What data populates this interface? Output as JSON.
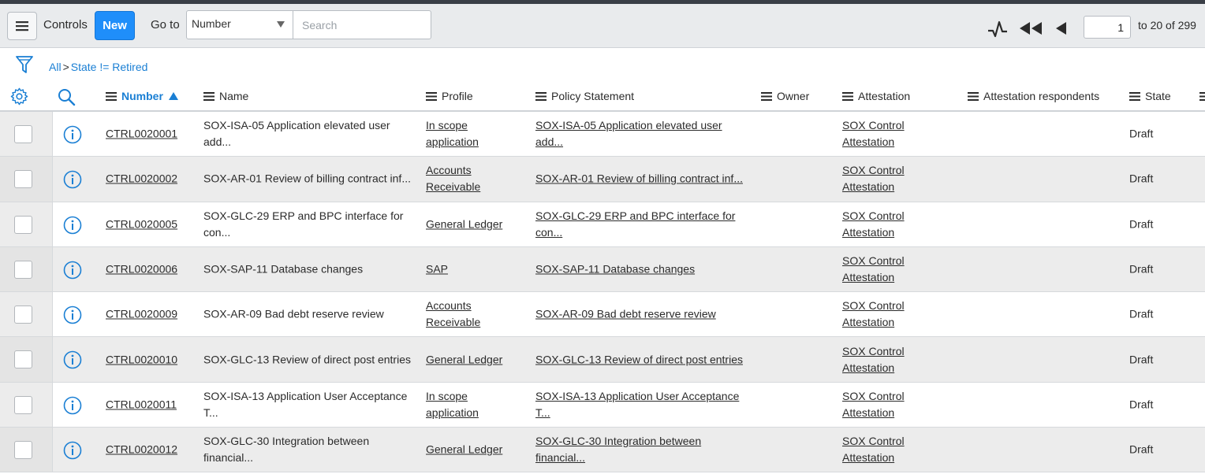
{
  "toolbar": {
    "title": "Controls",
    "new_label": "New",
    "goto_label": "Go to",
    "goto_field": "Number",
    "search_placeholder": "Search",
    "page_value": "1",
    "range_text": "to 20 of 299"
  },
  "breadcrumb": {
    "items": [
      "All",
      "State != Retired"
    ],
    "separator": ">"
  },
  "columns": {
    "number": "Number",
    "name": "Name",
    "profile": "Profile",
    "policy": "Policy Statement",
    "owner": "Owner",
    "attestation": "Attestation",
    "respondents": "Attestation respondents",
    "state": "State"
  },
  "colors": {
    "accent": "#1f8efa",
    "link_blue": "#1a7fd4",
    "toolbar_bg": "#e9ebed",
    "row_alt_bg": "#ececec"
  },
  "rows": [
    {
      "number": "CTRL0020001",
      "name": "SOX-ISA-05 Application elevated user add...",
      "profile": "In scope application",
      "policy": "SOX-ISA-05 Application elevated user add...",
      "owner": "",
      "attestation": "SOX Control Attestation",
      "respondents": "",
      "state": "Draft"
    },
    {
      "number": "CTRL0020002",
      "name": "SOX-AR-01 Review of billing contract inf...",
      "profile": "Accounts Receivable",
      "policy": "SOX-AR-01 Review of billing contract inf...",
      "owner": "",
      "attestation": "SOX Control Attestation",
      "respondents": "",
      "state": "Draft"
    },
    {
      "number": "CTRL0020005",
      "name": "SOX-GLC-29 ERP and BPC interface for con...",
      "profile": "General Ledger",
      "policy": "SOX-GLC-29 ERP and BPC interface for con...",
      "owner": "",
      "attestation": "SOX Control Attestation",
      "respondents": "",
      "state": "Draft"
    },
    {
      "number": "CTRL0020006",
      "name": "SOX-SAP-11 Database changes",
      "profile": "SAP",
      "policy": "SOX-SAP-11 Database changes",
      "owner": "",
      "attestation": "SOX Control Attestation",
      "respondents": "",
      "state": "Draft"
    },
    {
      "number": "CTRL0020009",
      "name": "SOX-AR-09 Bad debt reserve review",
      "profile": "Accounts Receivable",
      "policy": "SOX-AR-09 Bad debt reserve review",
      "owner": "",
      "attestation": "SOX Control Attestation",
      "respondents": "",
      "state": "Draft"
    },
    {
      "number": "CTRL0020010",
      "name": "SOX-GLC-13 Review of direct post entries",
      "profile": "General Ledger",
      "policy": "SOX-GLC-13 Review of direct post entries",
      "owner": "",
      "attestation": "SOX Control Attestation",
      "respondents": "",
      "state": "Draft"
    },
    {
      "number": "CTRL0020011",
      "name": "SOX-ISA-13 Application User Acceptance T...",
      "profile": "In scope application",
      "policy": "SOX-ISA-13 Application User Acceptance T...",
      "owner": "",
      "attestation": "SOX Control Attestation",
      "respondents": "",
      "state": "Draft"
    },
    {
      "number": "CTRL0020012",
      "name": "SOX-GLC-30 Integration between financial...",
      "profile": "General Ledger",
      "policy": "SOX-GLC-30 Integration between financial...",
      "owner": "",
      "attestation": "SOX Control Attestation",
      "respondents": "",
      "state": "Draft"
    }
  ]
}
